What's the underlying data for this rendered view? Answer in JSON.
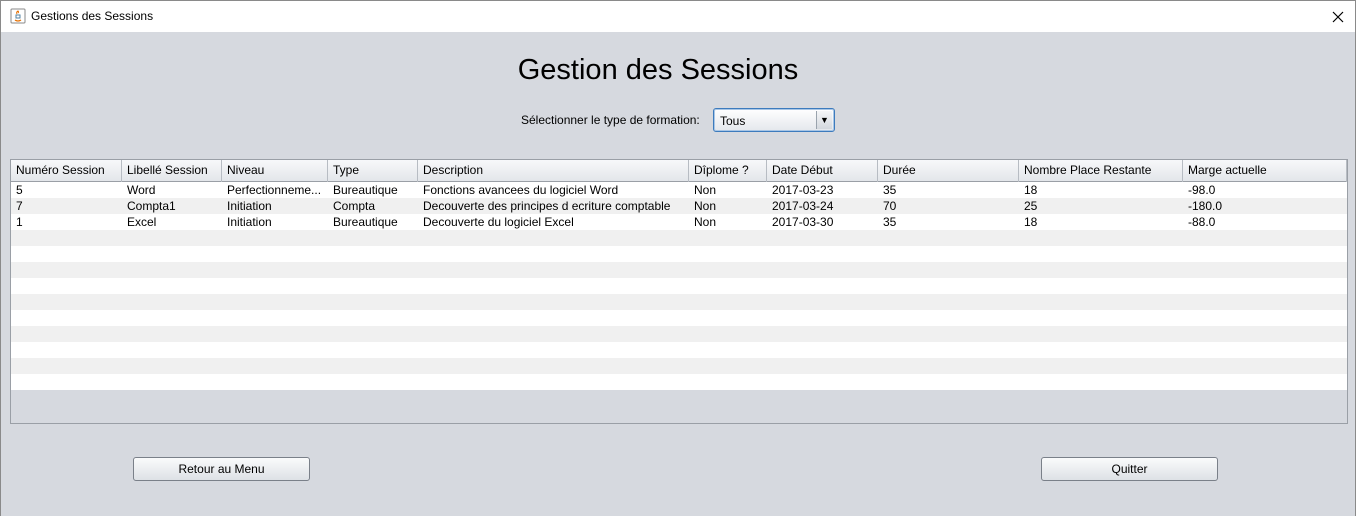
{
  "window": {
    "title": "Gestions des Sessions",
    "app_icon": "java-icon",
    "close_icon": "close-icon"
  },
  "heading": "Gestion des Sessions",
  "filter": {
    "label": "Sélectionner le type de formation:",
    "selected": "Tous"
  },
  "table": {
    "headers": [
      "Numéro Session",
      "Libellé Session",
      "Niveau",
      "Type",
      "Description",
      "Dîplome ?",
      "Date Début",
      "Durée",
      "Nombre Place Restante",
      "Marge actuelle"
    ],
    "rows": [
      [
        "5",
        "Word",
        "Perfectionneme...",
        "Bureautique",
        "Fonctions avancees du logiciel Word",
        "Non",
        "2017-03-23",
        "35",
        "18",
        "-98.0"
      ],
      [
        "7",
        "Compta1",
        "Initiation",
        "Compta",
        "Decouverte des principes d ecriture comptable",
        "Non",
        "2017-03-24",
        "70",
        "25",
        "-180.0"
      ],
      [
        "1",
        "Excel",
        "Initiation",
        "Bureautique",
        "Decouverte du logiciel Excel",
        "Non",
        "2017-03-30",
        "35",
        "18",
        "-88.0"
      ]
    ]
  },
  "buttons": {
    "back": "Retour au Menu",
    "quit": "Quitter"
  }
}
